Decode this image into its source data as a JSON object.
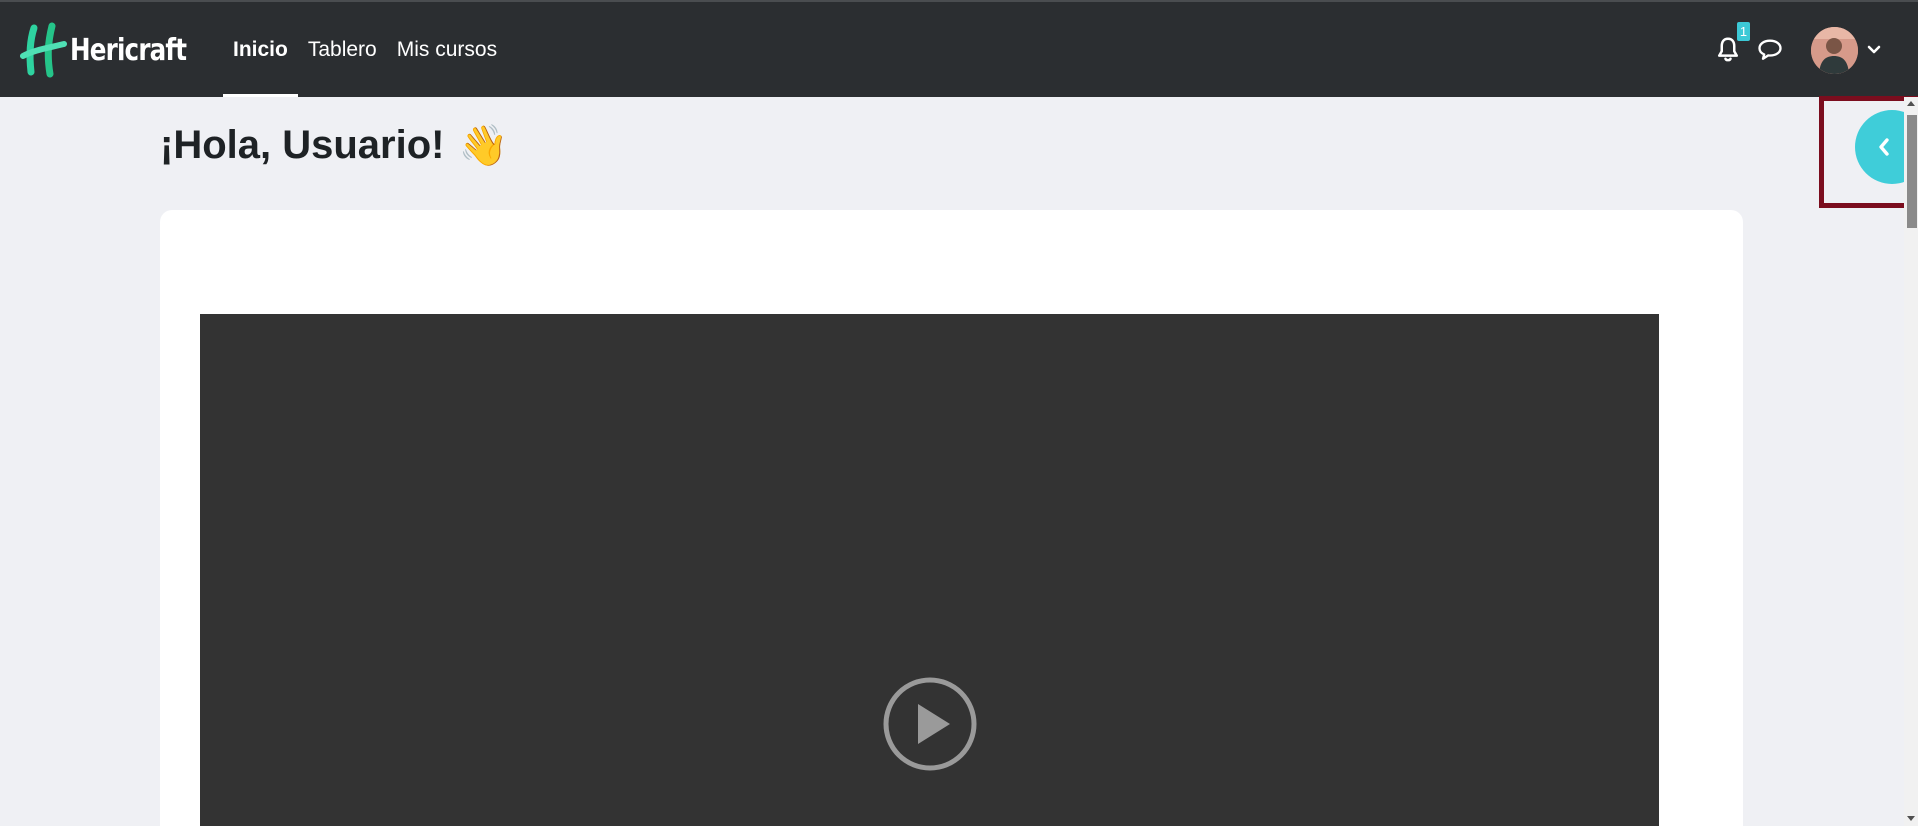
{
  "brand": {
    "name": "Hericraft",
    "accent": "#3fcdd9"
  },
  "nav": {
    "items": [
      {
        "label": "Inicio",
        "active": true
      },
      {
        "label": "Tablero",
        "active": false
      },
      {
        "label": "Mis cursos",
        "active": false
      }
    ]
  },
  "header": {
    "notifications_count": "1",
    "icons": [
      "bell-icon",
      "chat-icon",
      "user-avatar",
      "chevron-down-icon"
    ]
  },
  "main": {
    "greeting": "¡Hola, Usuario!",
    "greeting_emoji": "👋"
  },
  "drawer": {
    "toggle_icon": "chevron-left-icon"
  }
}
